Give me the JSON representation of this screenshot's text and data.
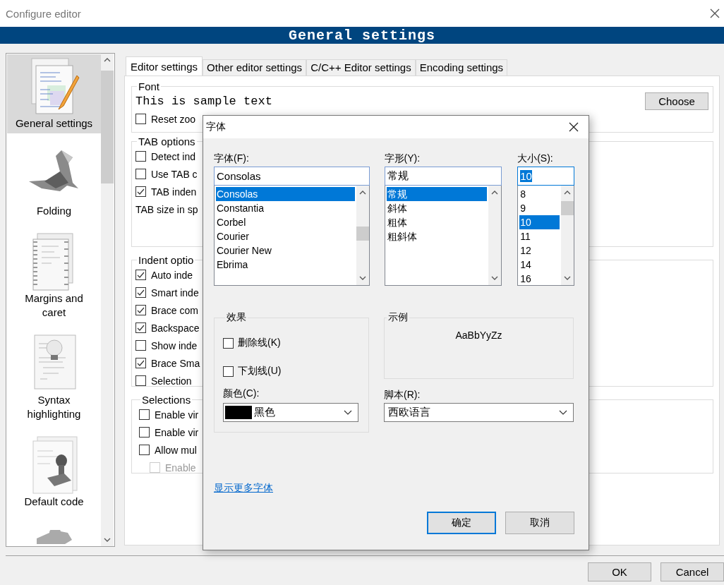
{
  "window": {
    "title": "Configure editor"
  },
  "header": {
    "title": "General settings"
  },
  "sidebar": {
    "items": [
      {
        "kind": "document-pencil",
        "label": "General settings",
        "selected": true
      },
      {
        "kind": "origami",
        "label": "Folding",
        "selected": false
      },
      {
        "kind": "pages",
        "label": "Margins and caret",
        "selected": false
      },
      {
        "kind": "bulb-page",
        "label": "Syntax highlighting",
        "selected": false
      },
      {
        "kind": "stamp-page",
        "label": "Default code",
        "selected": false
      },
      {
        "kind": "puzzle",
        "selected": false
      }
    ]
  },
  "tabs": [
    {
      "label": "Editor settings",
      "selected": true
    },
    {
      "label": "Other editor settings",
      "selected": false
    },
    {
      "label": "C/C++ Editor settings",
      "selected": false
    },
    {
      "label": "Encoding settings",
      "selected": false
    }
  ],
  "font_group": {
    "title": "Font",
    "sample": "This is sample text",
    "choose": "Choose",
    "reset_zoom": {
      "label": "Reset zoo",
      "checked": false
    }
  },
  "tab_options": {
    "title": "TAB options",
    "checkboxes": [
      {
        "label": "Detect ind",
        "checked": false
      },
      {
        "label": "Use TAB c",
        "checked": false
      },
      {
        "label": "TAB inden",
        "checked": true
      }
    ],
    "size_label": "TAB size in sp"
  },
  "indent_options": {
    "title": "Indent optio",
    "checkboxes": [
      {
        "label": "Auto inde",
        "checked": true
      },
      {
        "label": "Smart inde",
        "checked": true
      },
      {
        "label": "Brace com",
        "checked": true
      },
      {
        "label": "Backspace",
        "checked": true
      },
      {
        "label": "Show inde",
        "checked": false
      },
      {
        "label": "Brace Sma",
        "checked": true
      },
      {
        "label": "Selection",
        "checked": false
      }
    ]
  },
  "selections": {
    "title": "Selections",
    "checkboxes": [
      {
        "label": "Enable vir",
        "checked": false,
        "disabled": false
      },
      {
        "label": "Enable vir",
        "checked": false,
        "disabled": false
      },
      {
        "label": "Allow mul",
        "checked": false,
        "disabled": false
      },
      {
        "label": "Enable",
        "checked": false,
        "disabled": true
      }
    ]
  },
  "footer": {
    "buttons": [
      "OK",
      "Cancel"
    ]
  },
  "font_dialog": {
    "title": "字体",
    "font": {
      "label": "字体(F):",
      "value": "Consolas",
      "items": [
        {
          "label": "Consolas",
          "selected": true
        },
        {
          "label": "Constantia",
          "selected": false
        },
        {
          "label": "Corbel",
          "selected": false
        },
        {
          "label": "Courier",
          "selected": false
        },
        {
          "label": "Courier New",
          "selected": false
        },
        {
          "label": "Ebrima",
          "selected": false
        }
      ]
    },
    "style": {
      "label": "字形(Y):",
      "value": "常规",
      "items": [
        {
          "label": "常规",
          "selected": true
        },
        {
          "label": "斜体",
          "selected": false
        },
        {
          "label": "粗体",
          "selected": false
        },
        {
          "label": "粗斜体",
          "selected": false
        }
      ]
    },
    "size": {
      "label": "大小(S):",
      "value": "10",
      "items": [
        {
          "label": "8",
          "selected": false
        },
        {
          "label": "9",
          "selected": false
        },
        {
          "label": "10",
          "selected": true
        },
        {
          "label": "11",
          "selected": false
        },
        {
          "label": "12",
          "selected": false
        },
        {
          "label": "14",
          "selected": false
        },
        {
          "label": "16",
          "selected": false
        }
      ]
    },
    "effects": {
      "title": "效果",
      "checkboxes": [
        {
          "label": "删除线(K)",
          "checked": false
        },
        {
          "label": "下划线(U)",
          "checked": false
        }
      ],
      "color_label": "颜色(C):",
      "color_value": "黑色",
      "color": "#000000"
    },
    "sample": {
      "title": "示例",
      "text": "AaBbYyZz"
    },
    "script": {
      "label": "脚本(R):",
      "value": "西欧语言"
    },
    "more_fonts": "显示更多字体",
    "buttons": [
      "确定",
      "取消"
    ]
  }
}
